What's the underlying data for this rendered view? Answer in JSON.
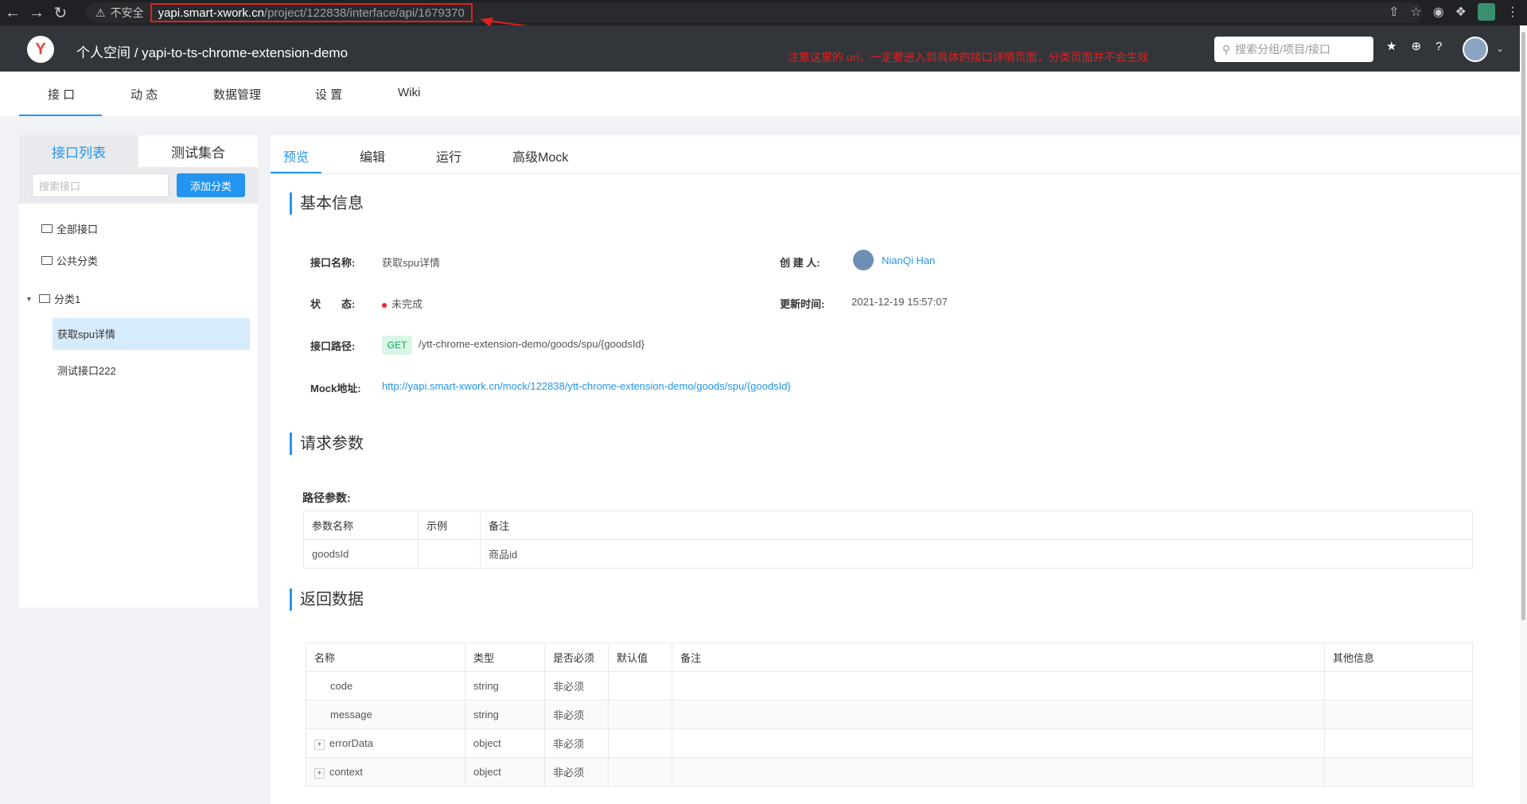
{
  "browser": {
    "insecure_label": "不安全",
    "url_host": "yapi.smart-xwork.cn",
    "url_path": "/project/122838/interface/api/1679370"
  },
  "annotation": {
    "note": "注意这里的 url，一定要进入到具体的接口详情页面，分类页面并不会生效",
    "color": "#e02020"
  },
  "header": {
    "breadcrumb": "个人空间  /  yapi-to-ts-chrome-extension-demo",
    "search_placeholder": "搜索分组/项目/接口"
  },
  "subnav": {
    "tabs": [
      "接 口",
      "动 态",
      "数据管理",
      "设 置",
      "Wiki"
    ]
  },
  "sidebar": {
    "tabs": [
      "接口列表",
      "测试集合"
    ],
    "search_placeholder": "搜索接口",
    "add_button": "添加分类",
    "tree": [
      "全部接口",
      "公共分类",
      "分类1",
      "获取spu详情",
      "测试接口222"
    ]
  },
  "main": {
    "tabs": [
      "预览",
      "编辑",
      "运行",
      "高级Mock"
    ],
    "basic_title": "基本信息",
    "labels": {
      "name": "接口名称:",
      "creator": "创 建 人:",
      "status": "状　　态:",
      "updated": "更新时间:",
      "path": "接口路径:",
      "mock": "Mock地址:"
    },
    "values": {
      "name": "获取spu详情",
      "creator": "NianQi Han",
      "status": "未完成",
      "updated": "2021-12-19 15:57:07",
      "method": "GET",
      "path": "/ytt-chrome-extension-demo/goods/spu/{goodsId}",
      "mock": "http://yapi.smart-xwork.cn/mock/122838/ytt-chrome-extension-demo/goods/spu/{goodsId}"
    },
    "request_title": "请求参数",
    "path_params_label": "路径参数:",
    "path_params_headers": [
      "参数名称",
      "示例",
      "备注"
    ],
    "path_params_rows": [
      [
        "goodsId",
        "",
        "商品id"
      ]
    ],
    "response_title": "返回数据",
    "response_headers": [
      "名称",
      "类型",
      "是否必须",
      "默认值",
      "备注",
      "其他信息"
    ],
    "response_rows": [
      {
        "name": "code",
        "type": "string",
        "required": "非必须",
        "expand": ""
      },
      {
        "name": "message",
        "type": "string",
        "required": "非必须",
        "expand": ""
      },
      {
        "name": "errorData",
        "type": "object",
        "required": "非必须",
        "expand": "+"
      },
      {
        "name": "context",
        "type": "object",
        "required": "非必须",
        "expand": "+"
      }
    ]
  }
}
